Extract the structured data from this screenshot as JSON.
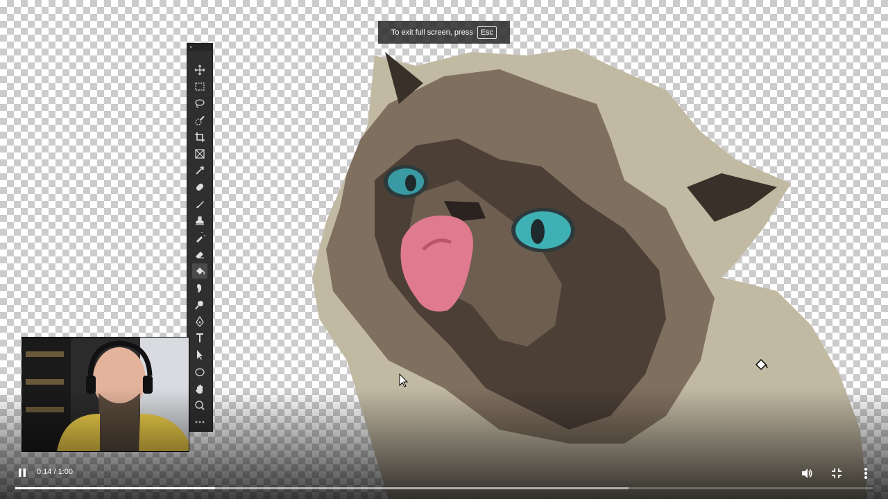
{
  "fullscreen_notice": {
    "text": "To exit full screen, press",
    "key": "Esc"
  },
  "toolbar": {
    "grip_label": "»",
    "tools": [
      "move-tool-icon",
      "rectangular-marquee-tool-icon",
      "lasso-tool-icon",
      "quick-selection-tool-icon",
      "crop-tool-icon",
      "frame-tool-icon",
      "eyedropper-tool-icon",
      "spot-healing-brush-tool-icon",
      "brush-tool-icon",
      "clone-stamp-tool-icon",
      "history-brush-tool-icon",
      "eraser-tool-icon",
      "paint-bucket-tool-icon",
      "smudge-tool-icon",
      "dodge-tool-icon",
      "pen-tool-icon",
      "type-tool-icon",
      "path-selection-tool-icon",
      "ellipse-tool-icon",
      "hand-tool-icon",
      "zoom-tool-icon",
      "more-tools-icon"
    ],
    "active_tool": "paint-bucket-tool-icon"
  },
  "player": {
    "time": "0:14 / 1:00",
    "played_fraction": 0.2333,
    "buffered_fraction": 0.715,
    "play_state": "pause-icon",
    "icons": [
      "volume-icon",
      "exit-fullscreen-icon",
      "more-options-icon"
    ]
  }
}
